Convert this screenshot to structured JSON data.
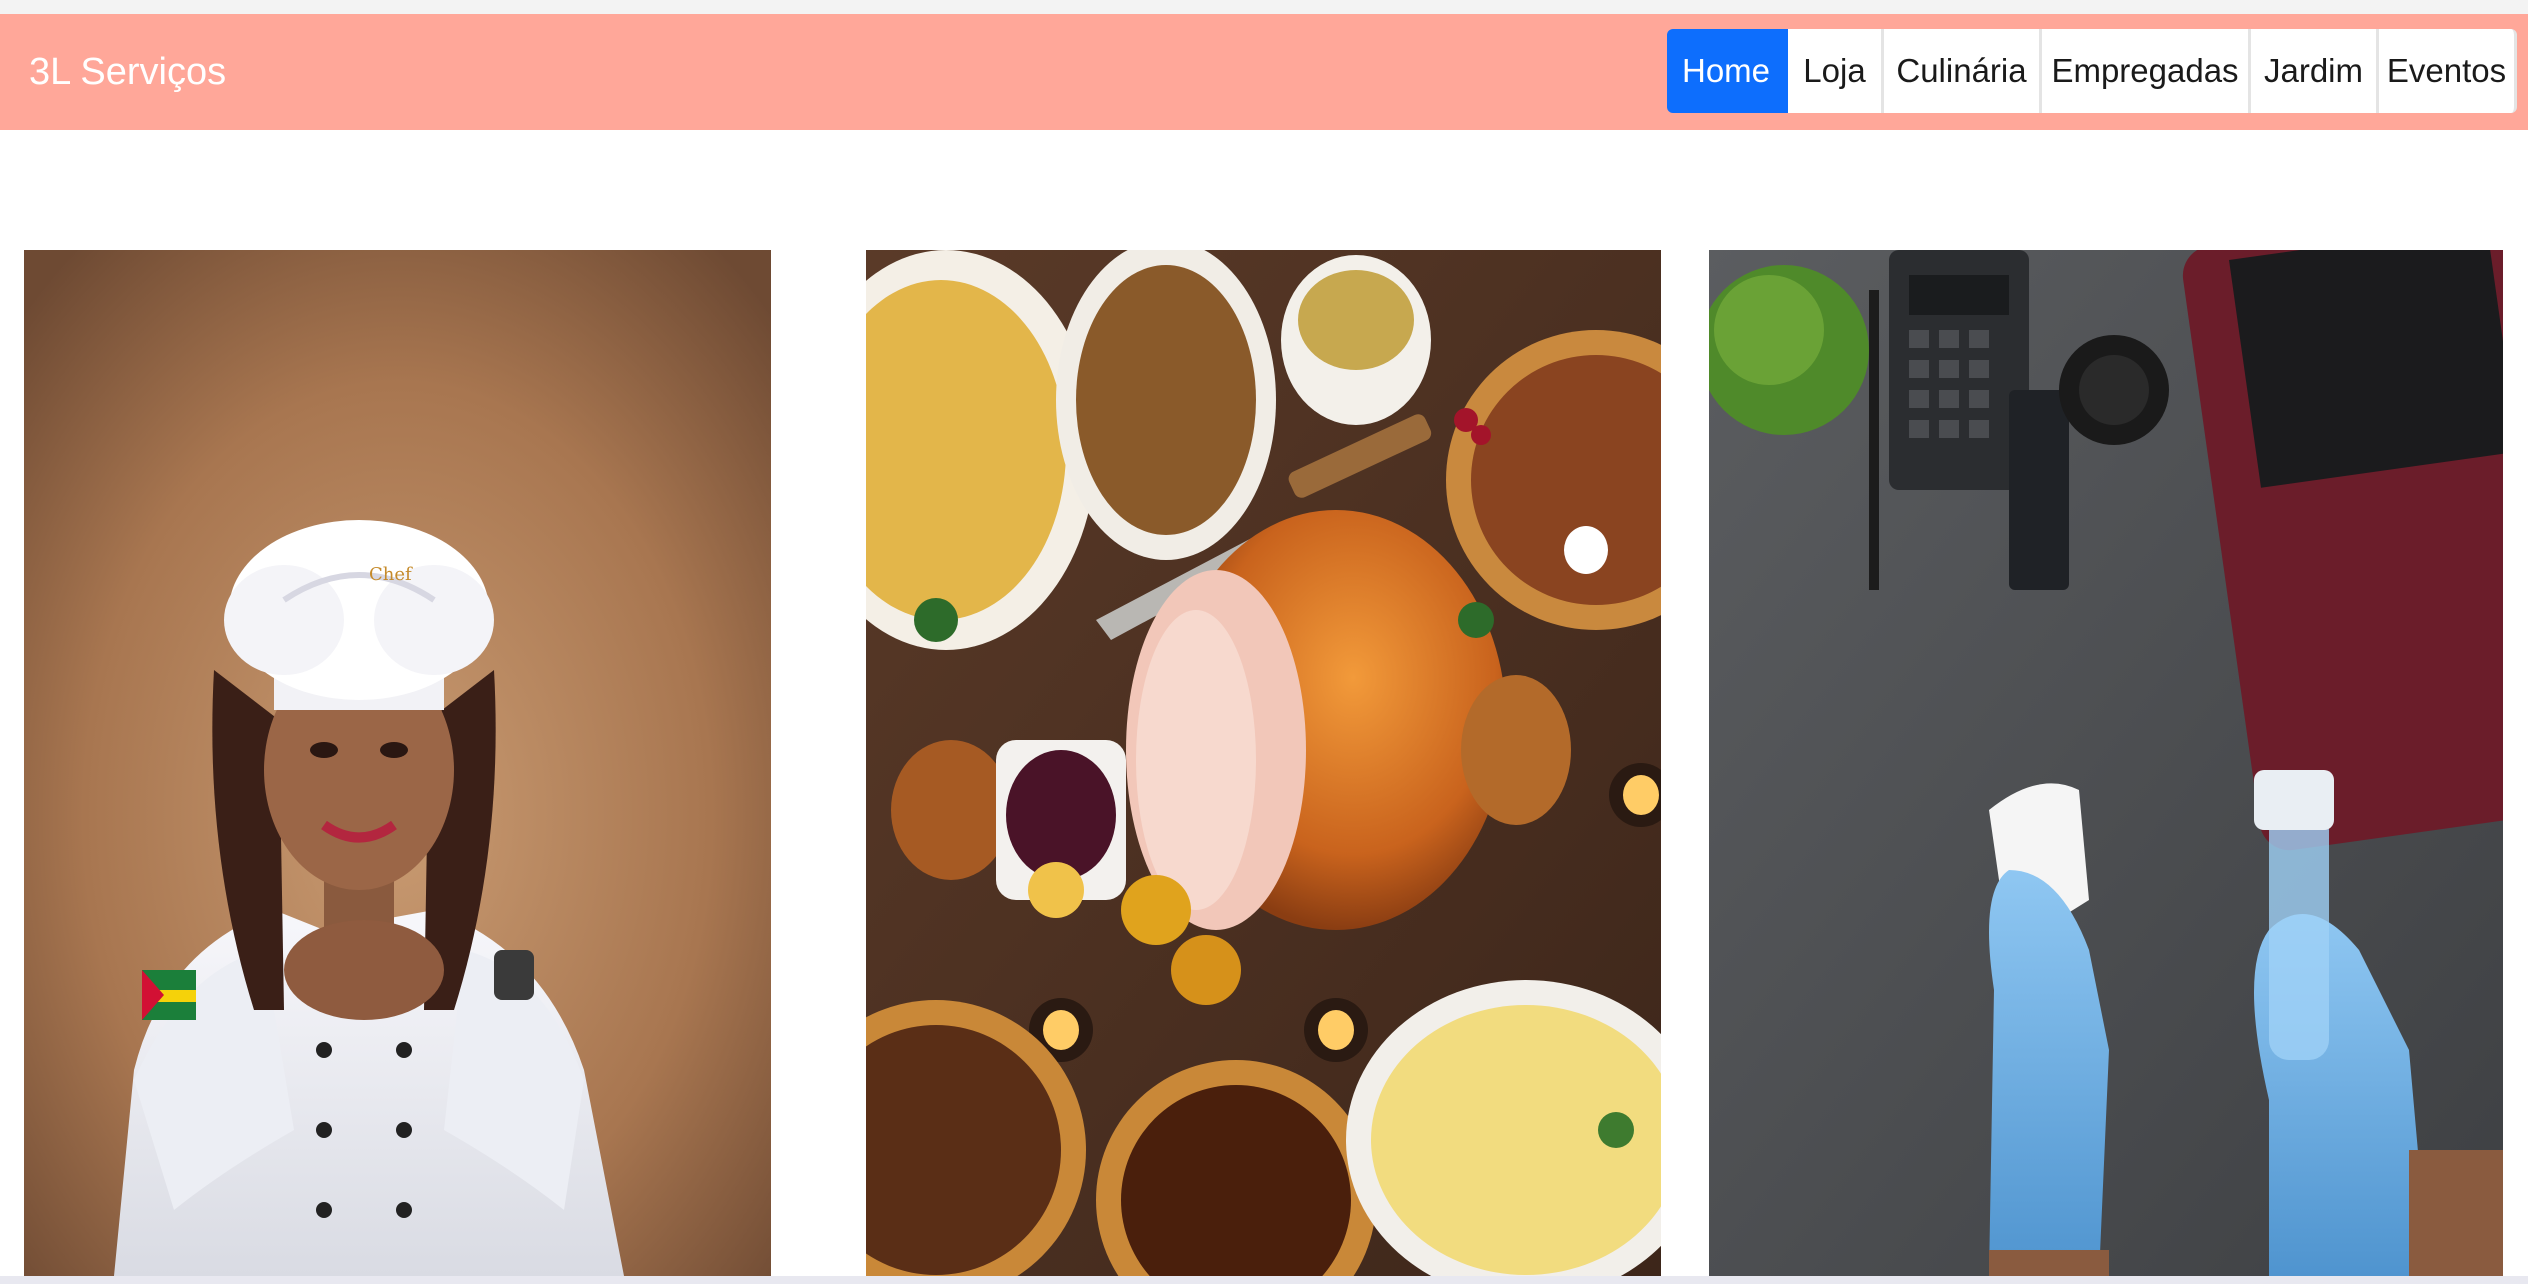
{
  "navbar": {
    "brand": "3L Serviços",
    "items": [
      {
        "label": "Home",
        "active": true
      },
      {
        "label": "Loja",
        "active": false
      },
      {
        "label": "Culinária",
        "active": false
      },
      {
        "label": "Empregadas",
        "active": false
      },
      {
        "label": "Jardim",
        "active": false
      },
      {
        "label": "Eventos",
        "active": false
      }
    ],
    "colors": {
      "background": "#ffa799",
      "active": "#0d6efd"
    }
  },
  "gallery": {
    "cards": [
      {
        "subject": "chef-portrait"
      },
      {
        "subject": "holiday-feast"
      },
      {
        "subject": "cleaning-desk"
      }
    ]
  }
}
